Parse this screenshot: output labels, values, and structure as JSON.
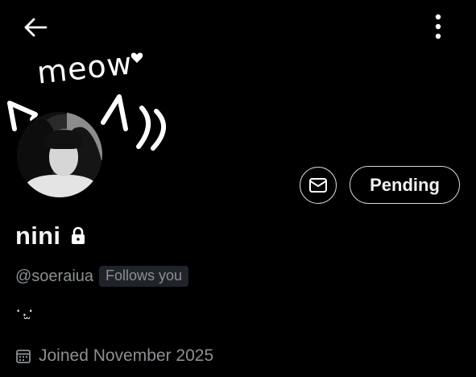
{
  "topbar": {
    "back_icon": "arrow-left-icon",
    "more_icon": "more-vertical-icon"
  },
  "banner": {
    "doodle_text": "meow"
  },
  "actions": {
    "message_icon": "envelope-icon",
    "pending_label": "Pending"
  },
  "profile": {
    "display_name": "nini",
    "lock_icon": "lock-icon",
    "handle": "@soeraiua",
    "follows_badge": "Follows you",
    "bio": "·.̫·",
    "joined_icon": "calendar-icon",
    "joined": "Joined November 2025"
  },
  "colors": {
    "background": "#000000",
    "text_primary": "#e7e9ea",
    "text_secondary": "#8b8f93",
    "badge_bg": "#202327",
    "button_border": "#cfd9de"
  }
}
